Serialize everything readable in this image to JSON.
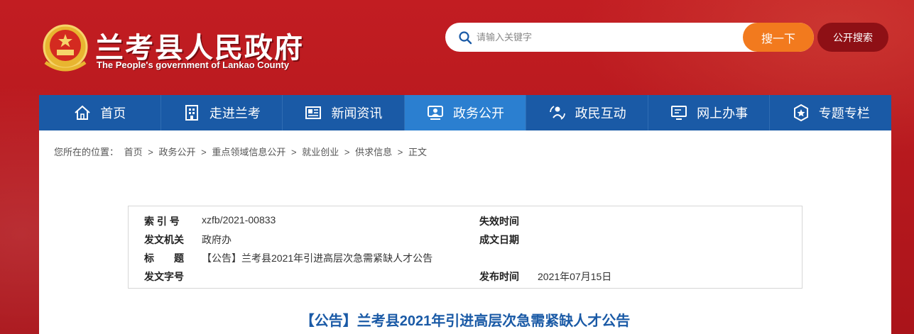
{
  "header": {
    "title": "兰考县人民政府",
    "subtitle": "The People's government of Lankao County"
  },
  "search": {
    "placeholder": "请输入关键字",
    "button_label": "搜一下",
    "open_search_label": "公开搜索"
  },
  "nav": {
    "items": [
      {
        "label": "首页",
        "icon": "home-icon"
      },
      {
        "label": "走进兰考",
        "icon": "building-icon"
      },
      {
        "label": "新闻资讯",
        "icon": "newspaper-icon"
      },
      {
        "label": "政务公开",
        "icon": "people-icon",
        "active": true
      },
      {
        "label": "政民互动",
        "icon": "interaction-icon"
      },
      {
        "label": "网上办事",
        "icon": "computer-icon"
      },
      {
        "label": "专题专栏",
        "icon": "star-badge-icon"
      }
    ]
  },
  "breadcrumb": {
    "prefix": "您所在的位置：",
    "items": [
      "首页",
      "政务公开",
      "重点领域信息公开",
      "就业创业",
      "供求信息",
      "正文"
    ],
    "separator": ">"
  },
  "meta": {
    "index_label": "索 引 号",
    "index_value": "xzfb/2021-00833",
    "expire_label": "失效时间",
    "expire_value": "",
    "issuer_label": "发文机关",
    "issuer_value": "政府办",
    "date_label": "成文日期",
    "date_value": "",
    "title_label": "标　　题",
    "title_value": "【公告】兰考县2021年引进高层次急需紧缺人才公告",
    "docno_label": "发文字号",
    "docno_value": "",
    "publish_label": "发布时间",
    "publish_value": "2021年07月15日"
  },
  "article": {
    "title": "【公告】兰考县2021年引进高层次急需紧缺人才公告"
  },
  "colors": {
    "background_red": "#b3161c",
    "nav_blue": "#1a5aa6",
    "nav_active": "#2b7fd0",
    "search_orange": "#f27a1e"
  }
}
